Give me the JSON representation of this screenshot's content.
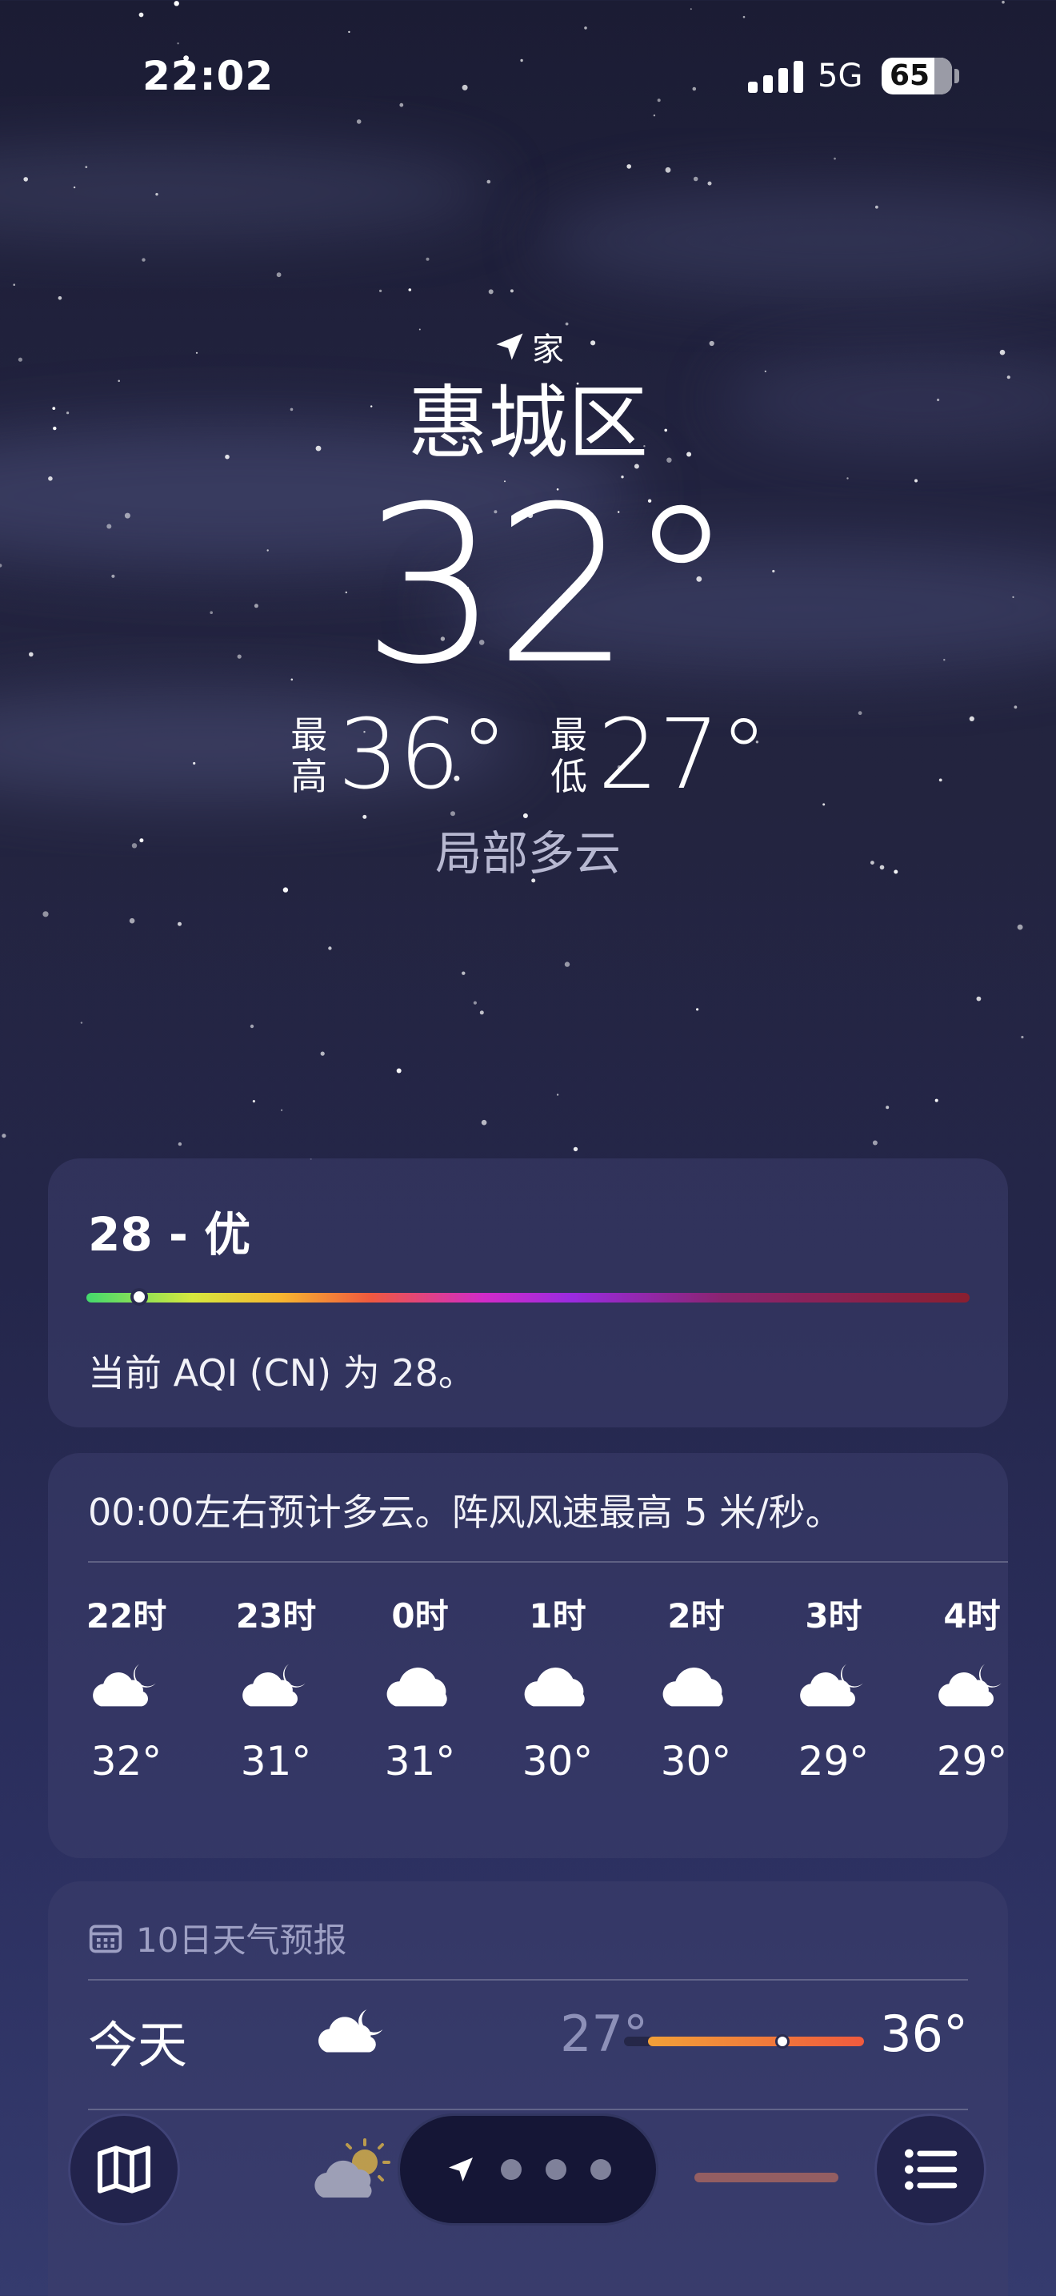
{
  "status_bar": {
    "time": "22:02",
    "network": "5G",
    "battery": "65"
  },
  "location": {
    "label": "家",
    "city": "惠城区"
  },
  "current": {
    "temperature": "32°",
    "high_label": "最高",
    "high": "36°",
    "low_label": "最低",
    "low": "27°",
    "condition": "局部多云"
  },
  "aqi": {
    "value_label": "28 - 优",
    "marker_position_pct": 6,
    "description": "当前 AQI (CN) 为 28。"
  },
  "hourly": {
    "summary": "00:00左右预计多云。阵风风速最高 5 米/秒。",
    "items": [
      {
        "time": "22时",
        "icon": "cloud-moon-icon",
        "temp": "32°"
      },
      {
        "time": "23时",
        "icon": "cloud-moon-icon",
        "temp": "31°"
      },
      {
        "time": "0时",
        "icon": "cloud-icon",
        "temp": "31°"
      },
      {
        "time": "1时",
        "icon": "cloud-icon",
        "temp": "30°"
      },
      {
        "time": "2时",
        "icon": "cloud-icon",
        "temp": "30°"
      },
      {
        "time": "3时",
        "icon": "cloud-moon-icon",
        "temp": "29°"
      },
      {
        "time": "4时",
        "icon": "cloud-moon-icon",
        "temp": "29°"
      }
    ]
  },
  "daily": {
    "title": "10日天气预报",
    "days": [
      {
        "name": "今天",
        "icon": "cloud-moon-icon",
        "low": "27°",
        "high": "36°",
        "range_start_pct": 10,
        "range_end_pct": 100,
        "current_pct": 66
      }
    ]
  },
  "tab_bar": {
    "map_icon": "map-icon",
    "location_icon": "location-arrow-icon",
    "list_icon": "list-icon",
    "page_count": 3
  },
  "colors": {
    "background_top": "#1b1c34",
    "background_bottom": "#353b6e",
    "card": "#3c3e6c",
    "muted_text": "#b7b8d1",
    "low_temp": "#8d90b8",
    "range_start": "#f2a038",
    "range_end": "#f05a3e"
  }
}
